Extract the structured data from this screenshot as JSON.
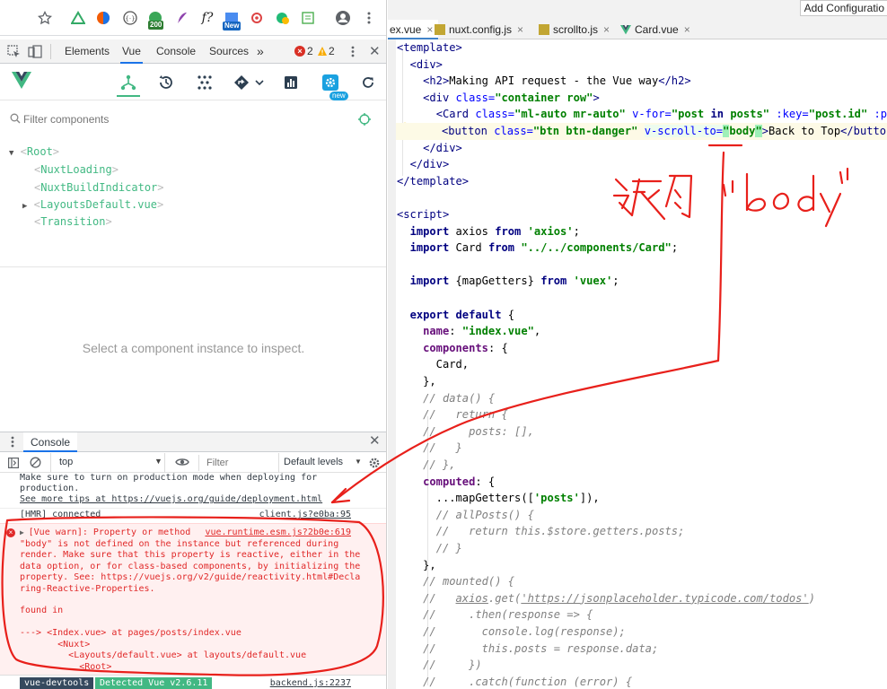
{
  "browser": {
    "extension_badges": [
      "200",
      "New"
    ]
  },
  "devtools": {
    "tabs": [
      "Elements",
      "Vue",
      "Console",
      "Sources"
    ],
    "more": "»",
    "error_count": "2",
    "warning_count": "2",
    "active_tab": "Vue"
  },
  "vue_devtools": {
    "new_badge": "new",
    "filter_placeholder": "Filter components",
    "tree": [
      {
        "name": "Root",
        "expanded": true
      },
      {
        "name": "NuxtLoading"
      },
      {
        "name": "NuxtBuildIndicator"
      },
      {
        "name": "LayoutsDefault.vue",
        "collapsed": true
      },
      {
        "name": "Transition"
      }
    ],
    "empty_inspect": "Select a component instance to inspect."
  },
  "console": {
    "tab_label": "Console",
    "context": "top",
    "filter_placeholder": "Filter",
    "levels": "Default levels",
    "pre_lines": [
      "Make sure to turn on production mode when deploying for",
      "production.",
      "See more tips at https://vuejs.org/guide/deployment.html"
    ],
    "hmr": "[HMR] connected",
    "hmr_src": "client.js?e0ba:95",
    "warn_src": "vue.runtime.esm.js?2b0e:619",
    "warn_lines": [
      "[Vue warn]: Property or method",
      "\"body\" is not defined on the instance but referenced during",
      "render. Make sure that this property is reactive, either in the",
      "data option, or for class-based components, by initializing the",
      "property. See: https://vuejs.org/v2/guide/reactivity.html#Decla",
      "ring-Reactive-Properties."
    ],
    "found_in": "found in",
    "trace": [
      "---> <Index.vue> at pages/posts/index.vue",
      "       <Nuxt>",
      "         <Layouts/default.vue> at layouts/default.vue",
      "           <Root>"
    ],
    "status_left": "vue-devtools",
    "status_detected": "Detected Vue v2.6.11",
    "status_src": "backend.js:2237"
  },
  "ide": {
    "add_config": "Add Configuratio",
    "tabs": [
      {
        "label": "ex.vue",
        "active": true
      },
      {
        "label": "nuxt.config.js"
      },
      {
        "label": "scrollto.js"
      },
      {
        "label": "Card.vue"
      }
    ]
  },
  "annotation": {
    "text": "改为",
    "quote": "\"body\"",
    "color": "#e8201b"
  }
}
